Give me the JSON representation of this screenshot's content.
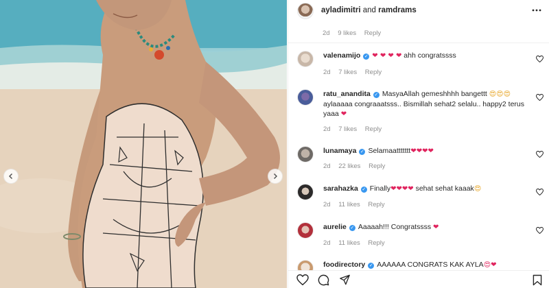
{
  "post": {
    "authors": {
      "first": "ayladimitri",
      "joiner": "and",
      "second": "ramdrams"
    },
    "top_meta": {
      "age": "2d",
      "likes": "9 likes",
      "reply": "Reply"
    }
  },
  "comments": [
    {
      "user": "valenamijo",
      "pre_emoji": "❤ ❤ ❤ ❤",
      "text": "ahh congratssss",
      "post_emoji": "",
      "age": "2d",
      "likes": "7 likes",
      "reply": "Reply"
    },
    {
      "user": "ratu_anandita",
      "pre_emoji": "",
      "text": "MasyaAllah gemeshhhh bangettt",
      "post_emoji": "😍😍😍",
      "text2": "aylaaaaa congraaatsss.. Bismillah sehat2 selalu.. happy2 terus yaaa",
      "post_emoji2": "❤",
      "age": "2d",
      "likes": "7 likes",
      "reply": "Reply"
    },
    {
      "user": "lunamaya",
      "pre_emoji": "",
      "text": "Selamaattttttt",
      "post_emoji": "❤❤❤❤",
      "age": "2d",
      "likes": "22 likes",
      "reply": "Reply"
    },
    {
      "user": "sarahazka",
      "pre_emoji": "",
      "text": "Finally",
      "post_emoji": "❤❤❤❤",
      "text2": " sehat sehat kaaak",
      "post_emoji2": "😍",
      "age": "2d",
      "likes": "11 likes",
      "reply": "Reply"
    },
    {
      "user": "aurelie",
      "pre_emoji": "",
      "text": "Aaaaah!!! Congratssss",
      "post_emoji": "❤",
      "age": "2d",
      "likes": "11 likes",
      "reply": "Reply"
    },
    {
      "user": "foodirectory",
      "pre_emoji": "",
      "text": "AAAAAA CONGRATS KAK AYLA",
      "post_emoji": "😍❤",
      "age": "",
      "likes": "",
      "reply": ""
    }
  ],
  "icons": {
    "more": "more-horizontal-icon",
    "like": "heart-outline-icon",
    "comment": "comment-bubble-icon",
    "share": "paper-plane-icon",
    "save": "bookmark-icon",
    "prev": "chevron-left-icon",
    "next": "chevron-right-icon"
  },
  "colors": {
    "verified": "#3897f0",
    "heart": "#e0245e",
    "muted": "#8e8e8e",
    "text": "#262626"
  }
}
